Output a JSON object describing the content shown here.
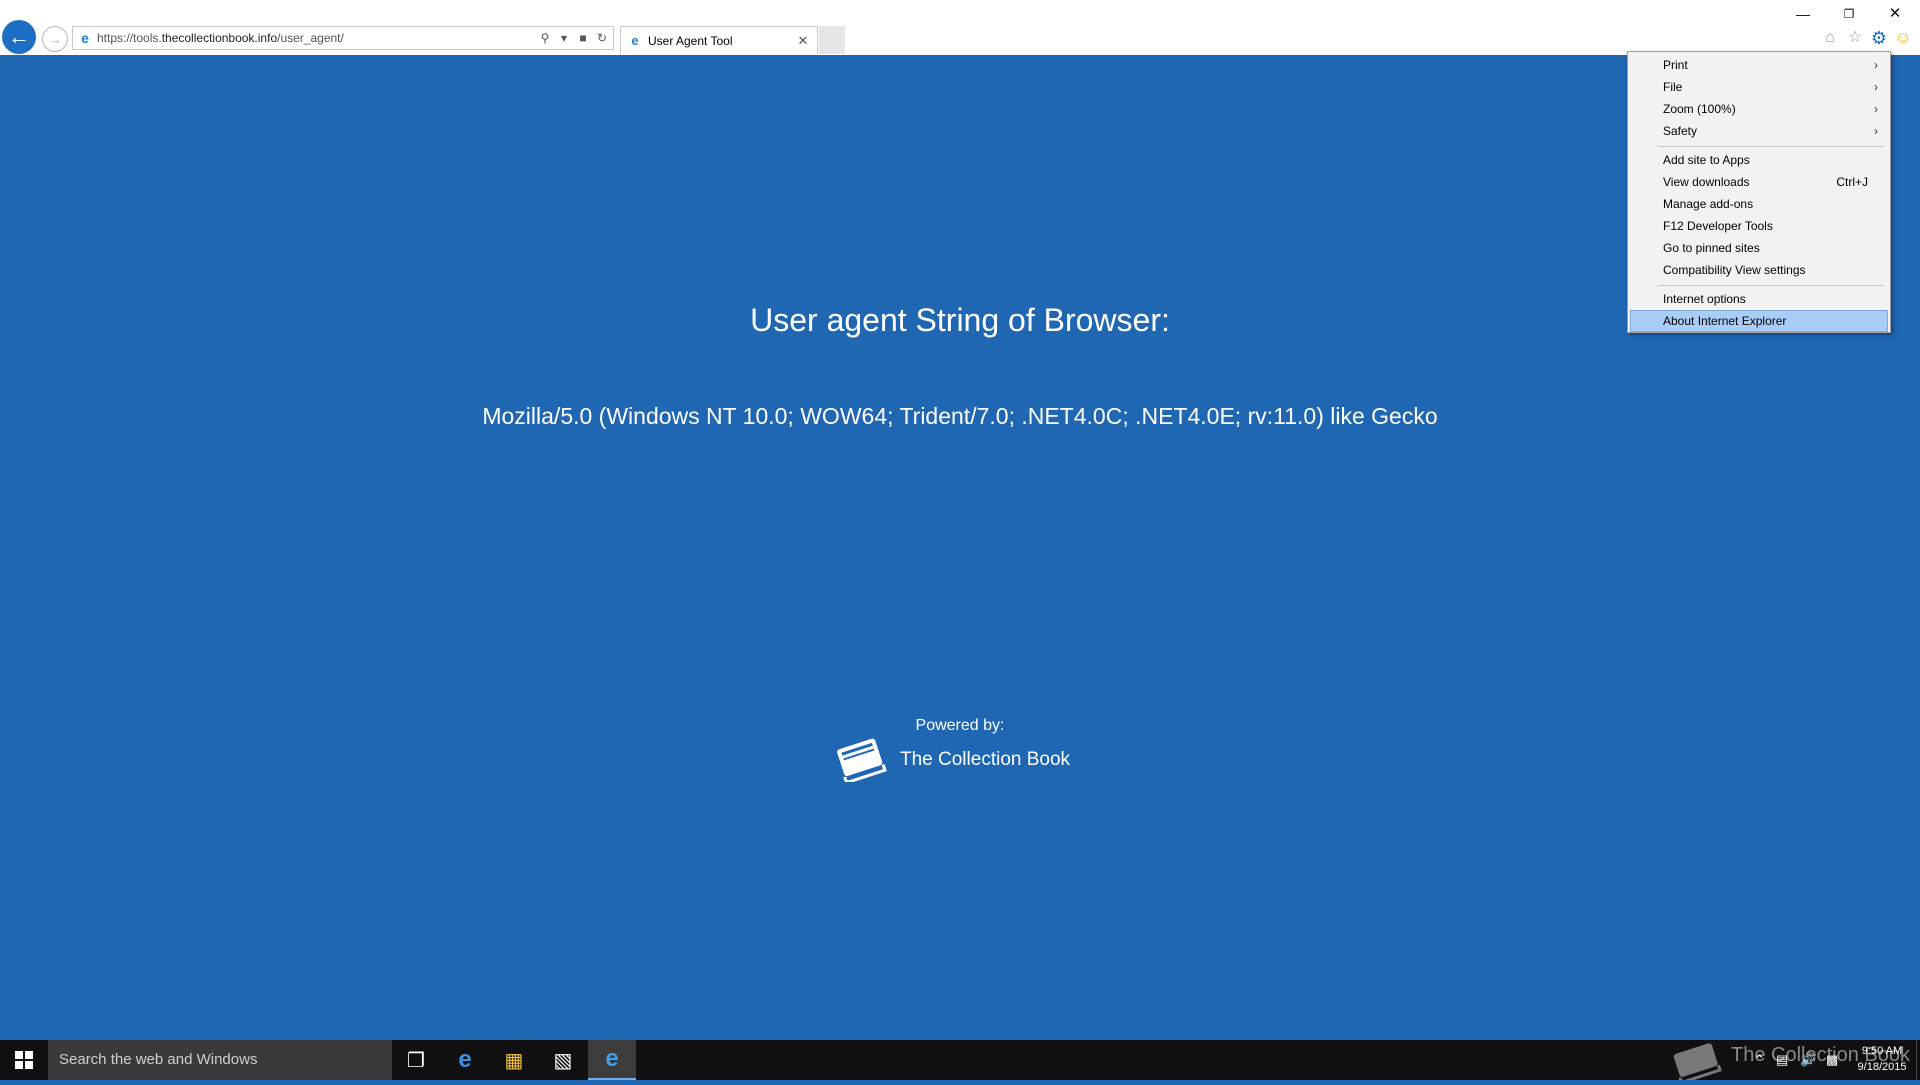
{
  "browser": {
    "url_prefix": "https://tools.",
    "url_domain": "thecollectionbook.info",
    "url_path": "/user_agent/",
    "tab_title": "User Agent Tool"
  },
  "page": {
    "heading": "User agent String of Browser:",
    "user_agent": "Mozilla/5.0 (Windows NT 10.0; WOW64; Trident/7.0; .NET4.0C; .NET4.0E; rv:11.0) like Gecko",
    "powered_by": "Powered by:",
    "brand_name": "The Collection Book"
  },
  "tools_menu": {
    "items": [
      {
        "label": "Print",
        "submenu": true
      },
      {
        "label": "File",
        "submenu": true
      },
      {
        "label": "Zoom (100%)",
        "submenu": true
      },
      {
        "label": "Safety",
        "submenu": true
      },
      {
        "label": "Add site to Apps"
      },
      {
        "label": "View downloads",
        "shortcut": "Ctrl+J"
      },
      {
        "label": "Manage add-ons"
      },
      {
        "label": "F12 Developer Tools"
      },
      {
        "label": "Go to pinned sites"
      },
      {
        "label": "Compatibility View settings"
      },
      {
        "label": "Internet options"
      },
      {
        "label": "About Internet Explorer",
        "highlighted": true
      }
    ],
    "highlight_color": "#a9cdf6"
  },
  "taskbar": {
    "search_placeholder": "Search the web and Windows",
    "watermark": "The Collection Book",
    "clock_time": "9:50 AM",
    "clock_date": "9/18/2015"
  },
  "colors": {
    "page_background": "#1f66b3",
    "accent": "#1c6fc4"
  }
}
